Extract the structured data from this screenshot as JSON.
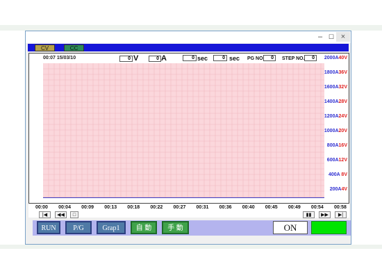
{
  "window": {
    "minimize_label": "–",
    "maximize_label": "☐",
    "close_label": "×"
  },
  "modes": {
    "cv_label": "CV",
    "cc_label": "CC"
  },
  "header": {
    "clock": "00:07  15/03/10",
    "voltage_value": "0",
    "voltage_unit": "V",
    "current_value": "0",
    "current_unit": "A",
    "time1_value": "0",
    "time1_unit": "sec",
    "time2_value": "0",
    "time2_unit": "sec",
    "pg_label": "PG NO.",
    "pg_value": "0",
    "step_label": "STEP NO.",
    "step_value": "0"
  },
  "colors": {
    "voltage_marker": "#e01010",
    "current_marker": "#1010c0",
    "grid_bg": "#fbd7dc",
    "grid_line": "#f0b7bf"
  },
  "chart_data": {
    "type": "line",
    "x_ticks": [
      "00:00",
      "00:04",
      "00:09",
      "00:13",
      "00:18",
      "00:22",
      "00:27",
      "00:31",
      "00:36",
      "00:40",
      "00:45",
      "00:49",
      "00:54",
      "00:58"
    ],
    "y_ticks": [
      {
        "a": "2000A",
        "v": "40V"
      },
      {
        "a": "1800A",
        "v": "36V"
      },
      {
        "a": "1600A",
        "v": "32V"
      },
      {
        "a": "1400A",
        "v": "28V"
      },
      {
        "a": "1200A",
        "v": "24V"
      },
      {
        "a": "1000A",
        "v": "20V"
      },
      {
        "a": "800A",
        "v": "16V"
      },
      {
        "a": "600A",
        "v": "12V"
      },
      {
        "a": "400A",
        "v": " 8V"
      },
      {
        "a": "200A",
        "v": "4V"
      }
    ],
    "series": [],
    "grid": true
  },
  "nav": {
    "first": "|◀",
    "prev": "◀◀",
    "marker": "□",
    "pause": "▮▮",
    "next": "▶▶",
    "last": "▶|"
  },
  "bottom": {
    "run": "RUN",
    "pg": "P/G",
    "graph": "Grap1",
    "auto": "自 動",
    "manual": "手 動",
    "on": "ON"
  }
}
